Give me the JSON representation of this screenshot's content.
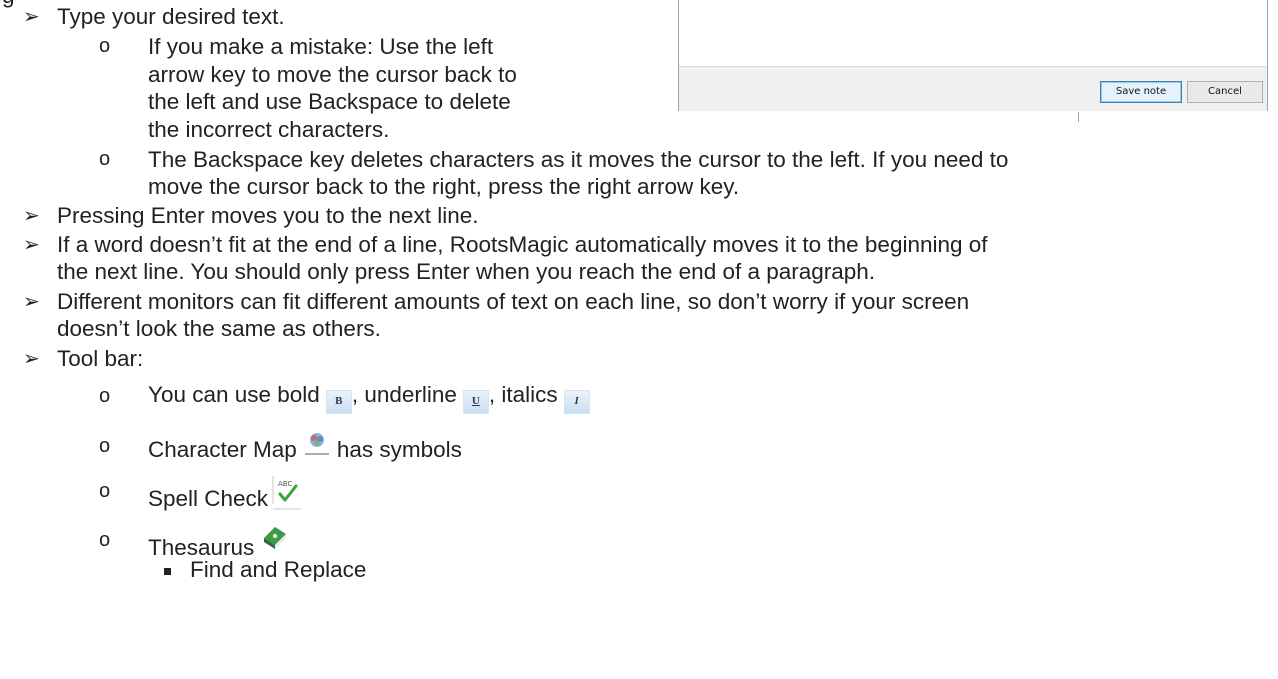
{
  "page": {
    "top_fragment": "g",
    "bullet_type": "Type your desired text.",
    "sub_mistake": [
      "If you make a mistake: Use the left",
      "arrow key to move the cursor back to",
      "the left and use Backspace to delete",
      "the incorrect characters."
    ],
    "sub_backspace": [
      "The Backspace key deletes characters as it moves the cursor to the left. If you need to",
      "move the cursor back to the right, press the right arrow key."
    ],
    "bullet_enter": "Pressing Enter moves you to the next line.",
    "bullet_wrap": [
      "If a word doesn’t fit at the end of a line, RootsMagic automatically moves it to the beginning of",
      "the next line. You should only press Enter when you reach the end of a paragraph."
    ],
    "bullet_monitors": [
      "Different monitors can fit different amounts of text on each line, so don’t worry if your screen",
      "doesn’t look the same as others."
    ],
    "bullet_toolbar": "Tool bar:",
    "toolbar_items": {
      "format_prefix": "You can use bold",
      "underline_word": ", underline",
      "italics_word": ", italics",
      "charmap_prefix": "Character Map",
      "charmap_suffix": "has symbols",
      "spell": "Spell Check",
      "thesaurus": "Thesaurus",
      "find_replace": "Find and Replace"
    },
    "icons": {
      "bold_glyph": "B",
      "underline_glyph": "U",
      "italic_glyph": "I",
      "spell_glyph": "ABC"
    }
  },
  "dialog": {
    "save_button": "Save note",
    "cancel_button": "Cancel"
  },
  "colors": {
    "check_green": "#3aa23a",
    "book_green": "#3e9a4a"
  }
}
